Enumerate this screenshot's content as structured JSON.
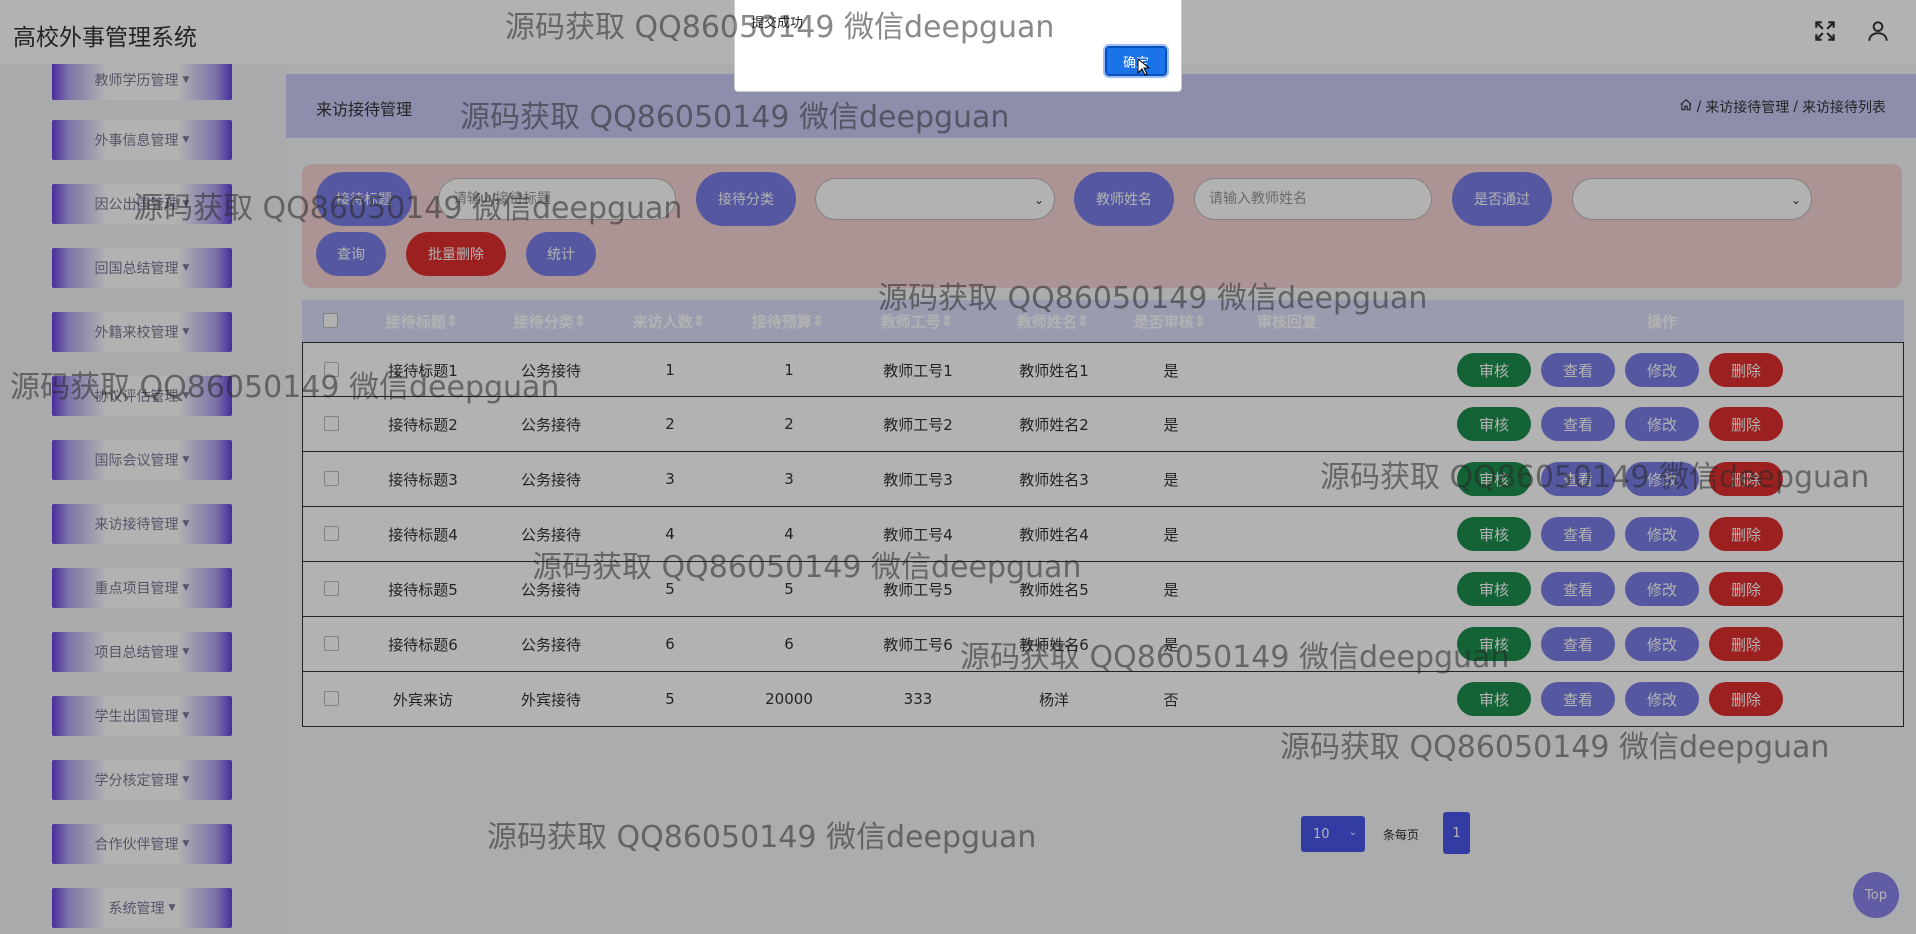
{
  "app": {
    "title": "高校外事管理系统"
  },
  "sidebar": {
    "items": [
      {
        "label": "教师学历管理"
      },
      {
        "label": "外事信息管理"
      },
      {
        "label": "因公出国管理"
      },
      {
        "label": "回国总结管理"
      },
      {
        "label": "外籍来校管理"
      },
      {
        "label": "协议评估管理"
      },
      {
        "label": "国际会议管理"
      },
      {
        "label": "来访接待管理"
      },
      {
        "label": "重点项目管理"
      },
      {
        "label": "项目总结管理"
      },
      {
        "label": "学生出国管理"
      },
      {
        "label": "学分核定管理"
      },
      {
        "label": "合作伙伴管理"
      },
      {
        "label": "系统管理"
      }
    ]
  },
  "page": {
    "title": "来访接待管理",
    "breadcrumb": [
      "来访接待管理",
      "来访接待列表"
    ]
  },
  "search": {
    "field1_label": "接待标题",
    "field1_placeholder": "请输入接待标题",
    "field2_label": "接待分类",
    "field3_label": "教师姓名",
    "field3_placeholder": "请输入教师姓名",
    "field4_label": "是否通过",
    "query_label": "查询",
    "batch_delete_label": "批量删除",
    "stats_label": "统计"
  },
  "table": {
    "headers": [
      "接待标题",
      "接待分类",
      "来访人数",
      "接待预算",
      "教师工号",
      "教师姓名",
      "是否审核",
      "审核回复",
      "操作"
    ],
    "rows": [
      {
        "title": "接待标题1",
        "category": "公务接待",
        "visitors": "1",
        "budget": "1",
        "teacher_id": "教师工号1",
        "teacher_name": "教师姓名1",
        "audited": "是",
        "reply": ""
      },
      {
        "title": "接待标题2",
        "category": "公务接待",
        "visitors": "2",
        "budget": "2",
        "teacher_id": "教师工号2",
        "teacher_name": "教师姓名2",
        "audited": "是",
        "reply": ""
      },
      {
        "title": "接待标题3",
        "category": "公务接待",
        "visitors": "3",
        "budget": "3",
        "teacher_id": "教师工号3",
        "teacher_name": "教师姓名3",
        "audited": "是",
        "reply": ""
      },
      {
        "title": "接待标题4",
        "category": "公务接待",
        "visitors": "4",
        "budget": "4",
        "teacher_id": "教师工号4",
        "teacher_name": "教师姓名4",
        "audited": "是",
        "reply": ""
      },
      {
        "title": "接待标题5",
        "category": "公务接待",
        "visitors": "5",
        "budget": "5",
        "teacher_id": "教师工号5",
        "teacher_name": "教师姓名5",
        "audited": "是",
        "reply": ""
      },
      {
        "title": "接待标题6",
        "category": "公务接待",
        "visitors": "6",
        "budget": "6",
        "teacher_id": "教师工号6",
        "teacher_name": "教师姓名6",
        "audited": "是",
        "reply": ""
      },
      {
        "title": "外宾来访",
        "category": "外宾接待",
        "visitors": "5",
        "budget": "20000",
        "teacher_id": "333",
        "teacher_name": "杨洋",
        "audited": "否",
        "reply": ""
      }
    ],
    "actions": {
      "audit": "审核",
      "view": "查看",
      "edit": "修改",
      "delete": "删除"
    }
  },
  "pagination": {
    "page_size": "10",
    "per_page_label": "条每页",
    "current_page": "1"
  },
  "back_to_top": "Top",
  "alert": {
    "message": "提交成功",
    "ok_label": "确定"
  },
  "watermark": "源码获取 QQ86050149 微信deepguan",
  "colors": {
    "audit_btn": "#1e8f4e",
    "view_btn": "#7a7fe6",
    "edit_btn": "#7a7fe6",
    "delete_btn": "#e12f2f",
    "search_btn": "#7a7fe6",
    "batch_delete_btn": "#e12f2f",
    "header_bg": "#c9ccf6",
    "pager": "#4a57e8"
  }
}
